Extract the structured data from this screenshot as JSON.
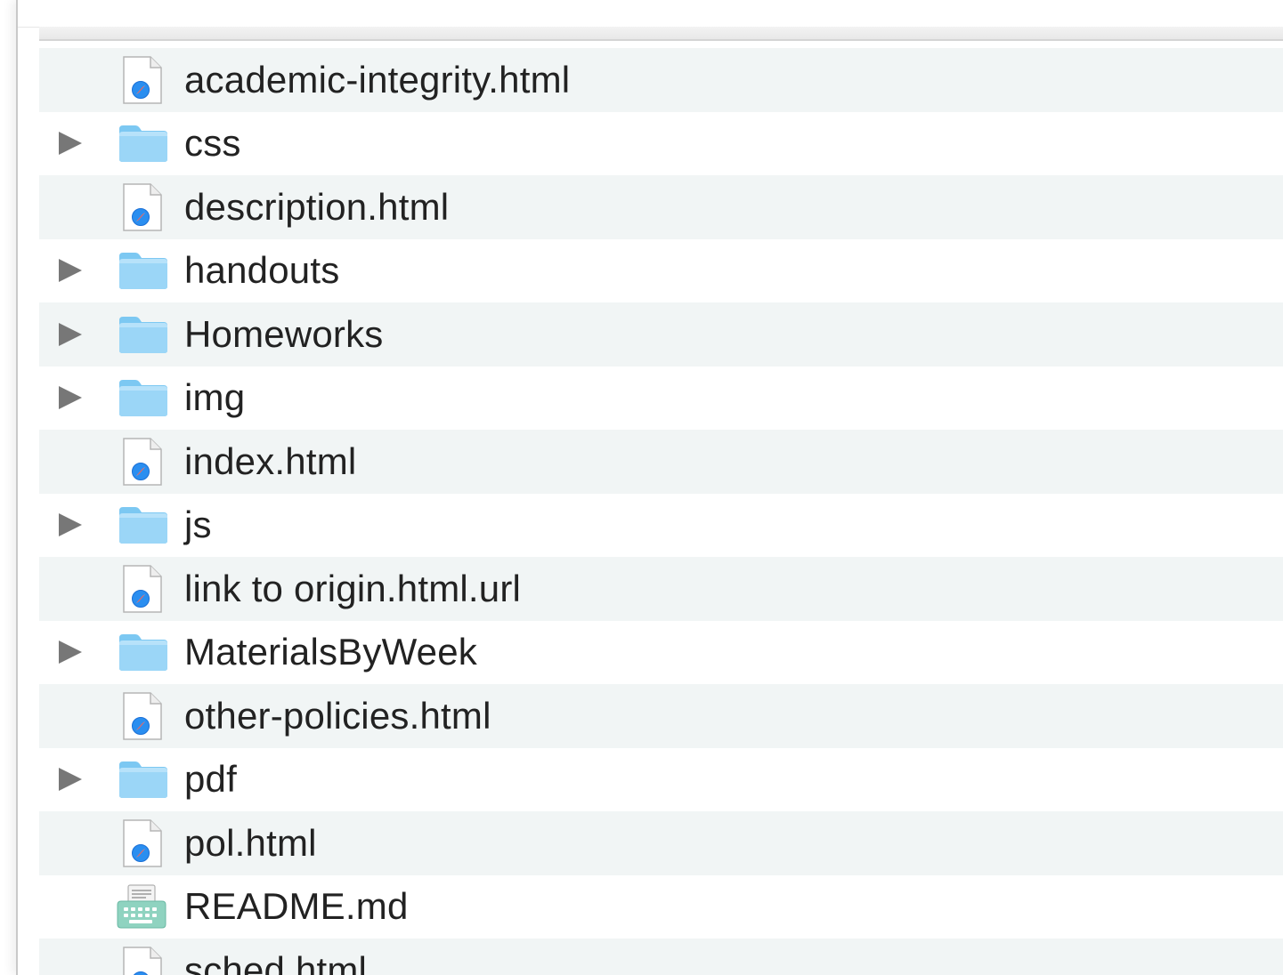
{
  "window": {
    "accent": "#5cbaf0"
  },
  "file_list": {
    "items": [
      {
        "name": "academic-integrity.html",
        "kind": "html",
        "icon": "safari-document-icon"
      },
      {
        "name": "css",
        "kind": "folder",
        "icon": "folder-icon"
      },
      {
        "name": "description.html",
        "kind": "html",
        "icon": "safari-document-icon"
      },
      {
        "name": "handouts",
        "kind": "folder",
        "icon": "folder-icon"
      },
      {
        "name": "Homeworks",
        "kind": "folder",
        "icon": "folder-icon"
      },
      {
        "name": "img",
        "kind": "folder",
        "icon": "folder-icon"
      },
      {
        "name": "index.html",
        "kind": "html",
        "icon": "safari-document-icon"
      },
      {
        "name": "js",
        "kind": "folder",
        "icon": "folder-icon"
      },
      {
        "name": "link to origin.html.url",
        "kind": "html",
        "icon": "safari-document-icon"
      },
      {
        "name": "MaterialsByWeek",
        "kind": "folder",
        "icon": "folder-icon"
      },
      {
        "name": "other-policies.html",
        "kind": "html",
        "icon": "safari-document-icon"
      },
      {
        "name": "pdf",
        "kind": "folder",
        "icon": "folder-icon"
      },
      {
        "name": "pol.html",
        "kind": "html",
        "icon": "safari-document-icon"
      },
      {
        "name": "README.md",
        "kind": "markdown",
        "icon": "markdown-document-icon"
      },
      {
        "name": "sched.html",
        "kind": "html",
        "icon": "safari-document-icon"
      }
    ]
  }
}
